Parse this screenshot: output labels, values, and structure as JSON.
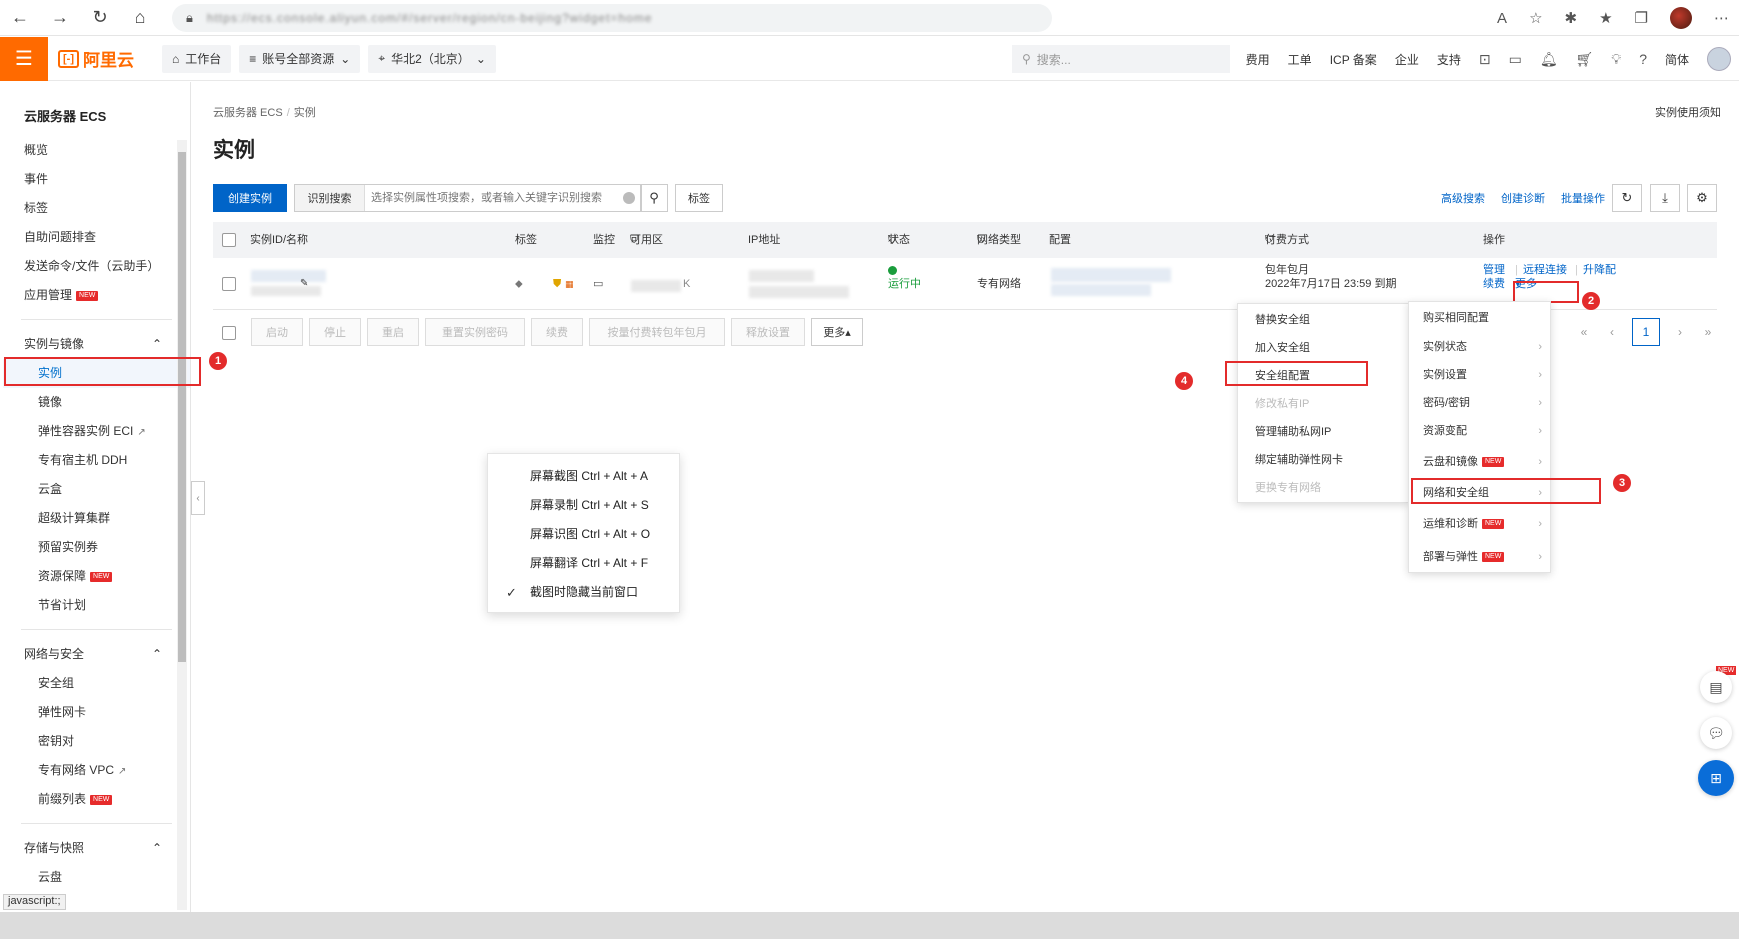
{
  "browser": {
    "address_text": "https://ecs.console.aliyun.com/#/server/region/cn-beijing?widget=home"
  },
  "topnav": {
    "logo_text": "阿里云",
    "logo_mark": "[-]",
    "workbench": "工作台",
    "resources": "账号全部资源",
    "region": "华北2（北京）",
    "search_placeholder": "搜索...",
    "links": [
      "费用",
      "工单",
      "ICP 备案",
      "企业",
      "支持"
    ],
    "language": "简体"
  },
  "sidebar": {
    "title": "云服务器 ECS",
    "top_items": [
      "概览",
      "事件",
      "标签",
      "自助问题排查",
      "发送命令/文件（云助手）",
      "应用管理"
    ],
    "group1": "实例与镜像",
    "group1_items": [
      "实例",
      "镜像",
      "弹性容器实例 ECI",
      "专有宿主机 DDH",
      "云盒",
      "超级计算集群",
      "预留实例券",
      "资源保障",
      "节省计划"
    ],
    "group2": "网络与安全",
    "group2_items": [
      "安全组",
      "弹性网卡",
      "密钥对",
      "专有网络 VPC",
      "前缀列表"
    ],
    "group3": "存储与快照",
    "group3_items": [
      "云盘"
    ],
    "new_badge": "NEW",
    "status_tip": "javascript:;"
  },
  "main": {
    "breadcrumb": [
      "云服务器 ECS",
      "实例"
    ],
    "notice_link": "实例使用须知",
    "title": "实例",
    "create_button": "创建实例",
    "search_kind": "识别搜索",
    "search_placeholder": "选择实例属性项搜索，或者输入关键字识别搜索",
    "tag_button": "标签",
    "tool_links": [
      "高级搜索",
      "创建诊断",
      "批量操作"
    ]
  },
  "table": {
    "headers": [
      "实例ID/名称",
      "标签",
      "监控",
      "可用区",
      "IP地址",
      "状态",
      "网络类型",
      "配置",
      "付费方式",
      "操作"
    ],
    "row": {
      "zone_suffix": "K",
      "status": "运行中",
      "network": "专有网络",
      "billing": "包年包月",
      "expire": "2022年7月17日 23:59 到期",
      "ops_row1": [
        "管理",
        "远程连接",
        "升降配"
      ],
      "ops_row2": [
        "续费",
        "更多"
      ]
    }
  },
  "batch": {
    "buttons": [
      "启动",
      "停止",
      "重启",
      "重置实例密码",
      "续费",
      "按量付费转包年包月",
      "释放设置"
    ],
    "more": "更多▴"
  },
  "pager": {
    "first": "«",
    "prev": "‹",
    "current": "1",
    "next": "›",
    "last": "»"
  },
  "submenu": {
    "items": [
      "替换安全组",
      "加入安全组",
      "安全组配置",
      "修改私有IP",
      "管理辅助私网IP",
      "绑定辅助弹性网卡",
      "更换专有网络"
    ]
  },
  "more_menu": {
    "items": [
      "购买相同配置",
      "实例状态",
      "实例设置",
      "密码/密钥",
      "资源变配",
      "云盘和镜像",
      "网络和安全组",
      "运维和诊断",
      "部署与弹性"
    ]
  },
  "steps": [
    "1",
    "2",
    "3",
    "4"
  ],
  "context_menu": {
    "items": [
      "屏幕截图 Ctrl + Alt + A",
      "屏幕录制 Ctrl + Alt + S",
      "屏幕识图 Ctrl + Alt + O",
      "屏幕翻译 Ctrl + Alt + F",
      "截图时隐藏当前窗口"
    ]
  },
  "colors": {
    "brand_orange": "#ff6a00",
    "primary_blue": "#0064c8",
    "highlight_red": "#e32b2b",
    "running_green": "#1a9d3c"
  }
}
